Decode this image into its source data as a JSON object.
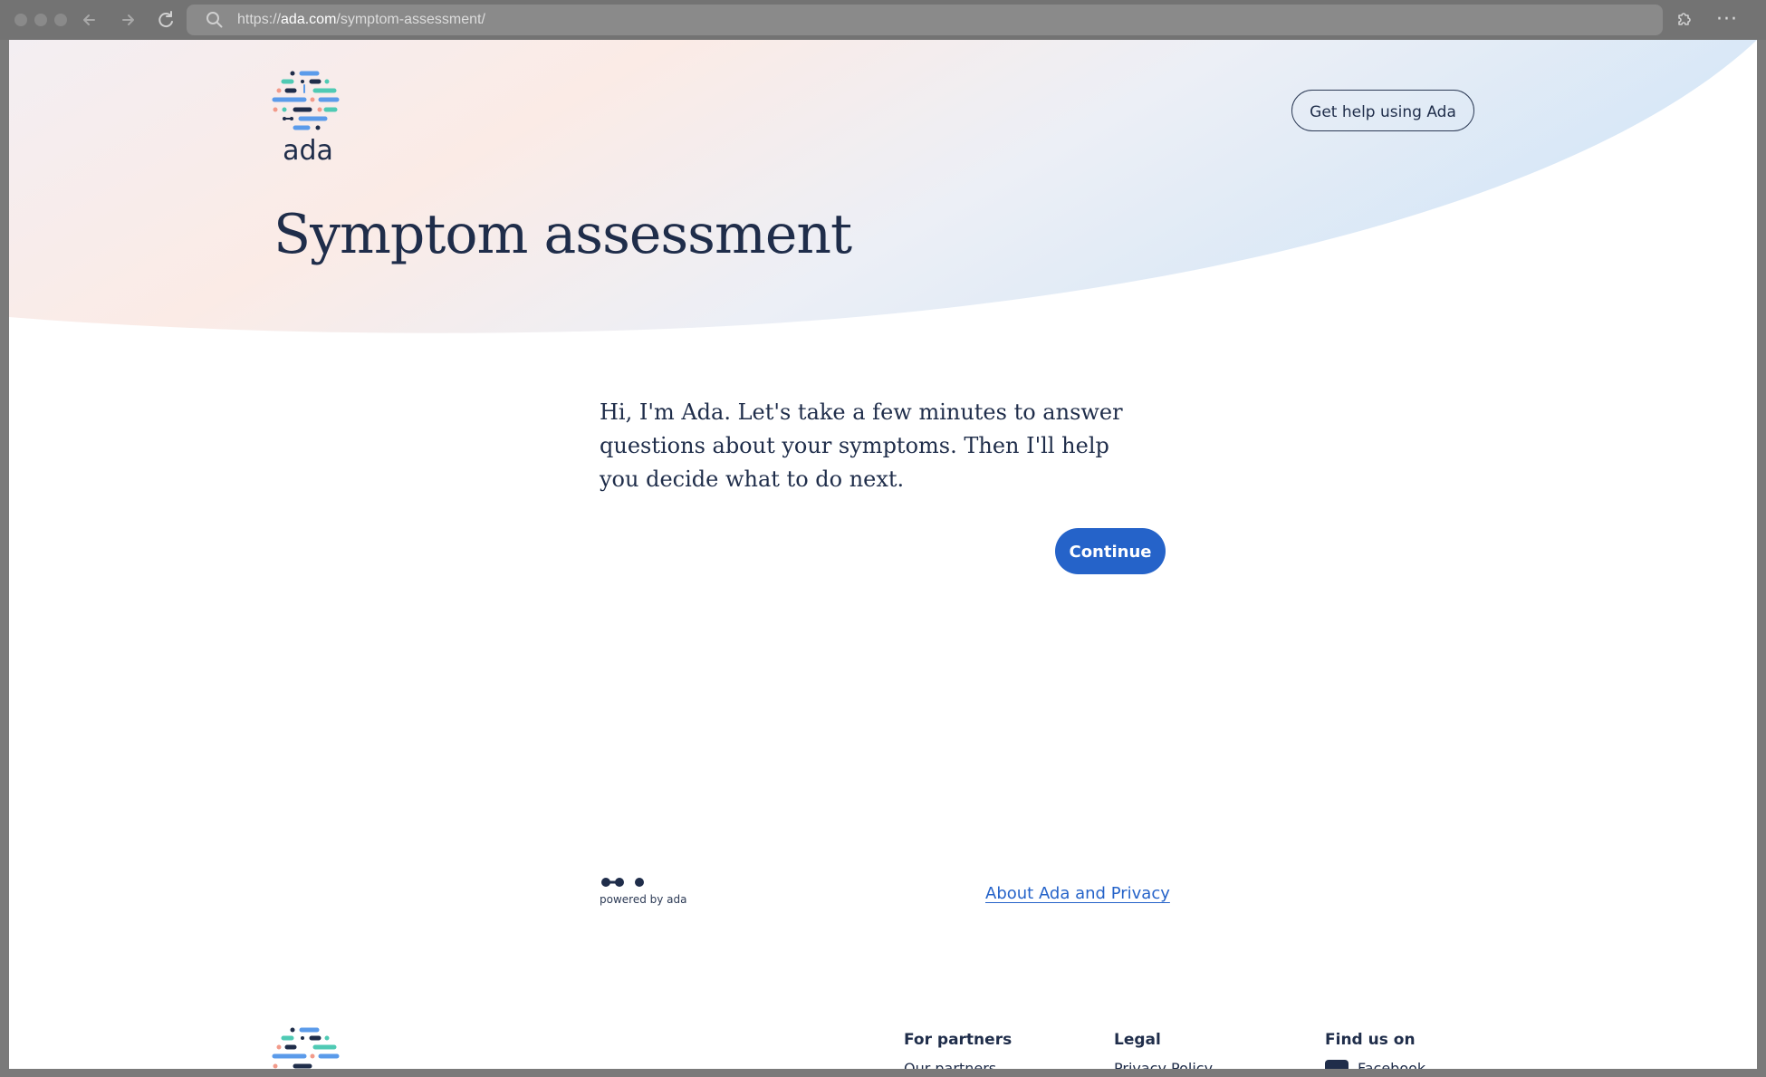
{
  "browser": {
    "url_scheme": "https://",
    "url_host": "ada.com",
    "url_path": "/symptom-assessment/",
    "back_icon": "arrow-left-icon",
    "forward_icon": "arrow-right-icon",
    "reload_icon": "reload-icon",
    "search_icon": "search-icon",
    "extension_icon": "puzzle-icon",
    "more_icon": "more-icon",
    "more_glyph": "···"
  },
  "header": {
    "logo_text": "ada",
    "help_button_label": "Get help using Ada"
  },
  "main": {
    "title": "Symptom assessment",
    "intro_text": "Hi, I'm Ada. Let's take a few minutes to answer questions about your symptoms. Then I'll help you decide what to do next.",
    "continue_label": "Continue"
  },
  "footer_strip": {
    "powered_by": "powered by ada",
    "about_link": "About Ada and Privacy"
  },
  "footer": {
    "columns": [
      {
        "heading": "For partners",
        "first_item": "Our partners"
      },
      {
        "heading": "Legal",
        "first_item": "Privacy Policy"
      },
      {
        "heading": "Find us on",
        "first_item": "Facebook"
      }
    ]
  },
  "colors": {
    "primary": "#2563c9",
    "text_dark": "#1f2d4a",
    "hero_gradient_warm": "#fbe9e4",
    "hero_gradient_cool": "#dbe8f8"
  }
}
